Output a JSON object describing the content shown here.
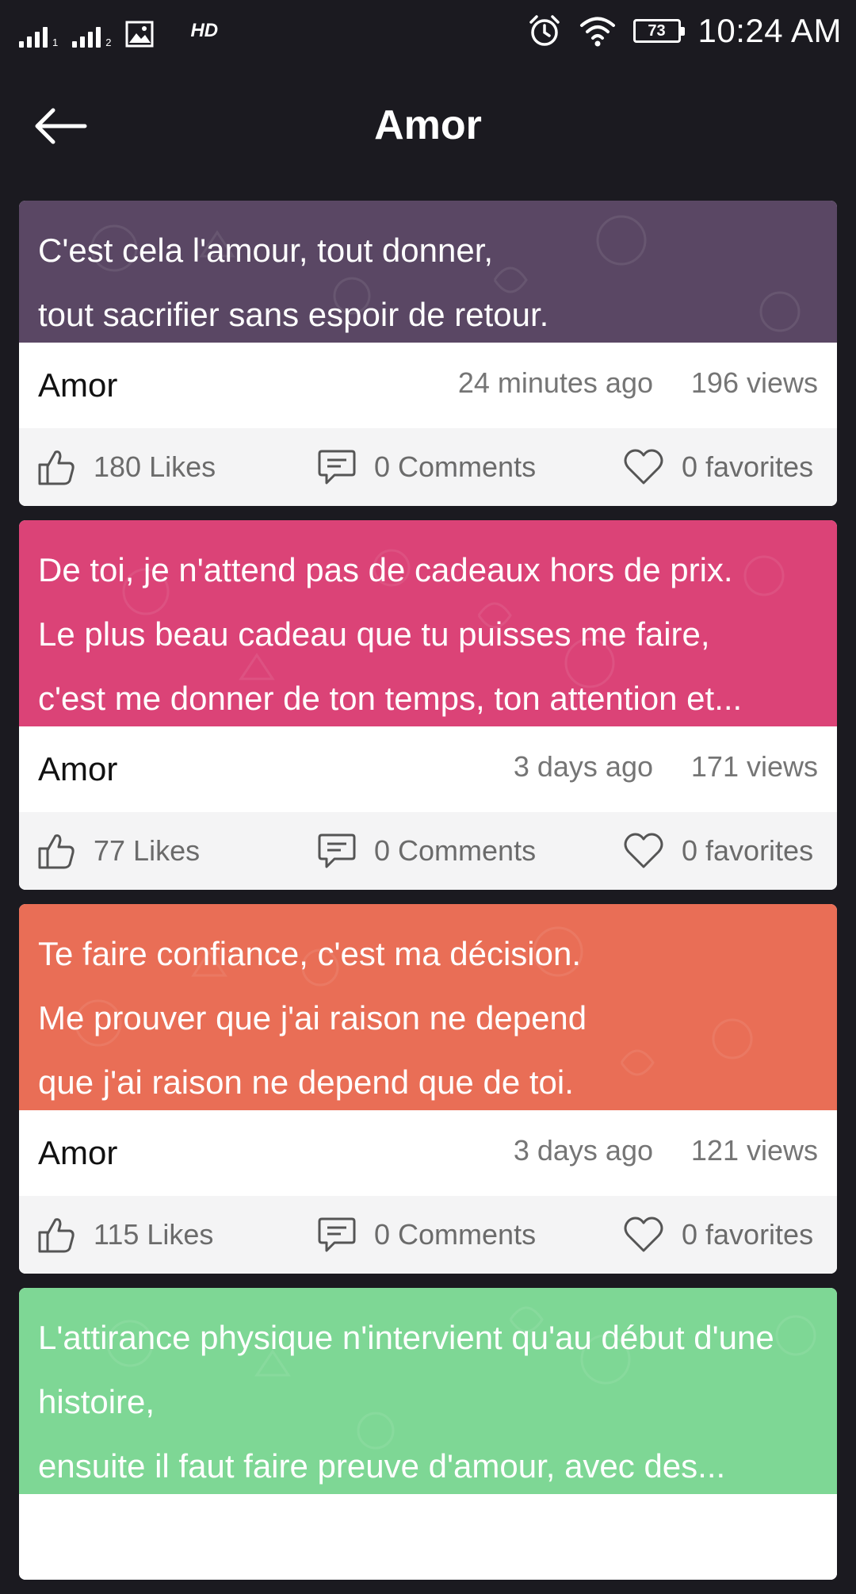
{
  "statusbar": {
    "hd": "HD",
    "battery": "73",
    "time": "10:24 AM"
  },
  "appbar": {
    "title": "Amor"
  },
  "colors": {
    "background": "#1b1a20",
    "card_purple": "#5a4764",
    "card_pink": "#db4377",
    "card_orange": "#e96e56",
    "card_green": "#7ed795"
  },
  "cards": [
    {
      "lines": [
        "C'est cela l'amour, tout donner,",
        "tout sacrifier sans espoir de retour."
      ],
      "author": "Amor",
      "time": "24 minutes ago",
      "views": "196 views",
      "likes": "180 Likes",
      "comments": "0 Comments",
      "favorites": "0 favorites"
    },
    {
      "lines": [
        "De toi, je n'attend pas de cadeaux hors de prix.",
        "Le plus beau cadeau que tu puisses me faire,",
        "c'est me donner de ton temps, ton attention et..."
      ],
      "author": "Amor",
      "time": "3 days ago",
      "views": "171 views",
      "likes": "77 Likes",
      "comments": "0 Comments",
      "favorites": "0 favorites"
    },
    {
      "lines": [
        "Te faire confiance, c'est ma décision.",
        "Me prouver que j'ai raison ne depend",
        "que j'ai raison ne depend que de toi."
      ],
      "author": "Amor",
      "time": "3 days ago",
      "views": "121 views",
      "likes": "115 Likes",
      "comments": "0 Comments",
      "favorites": "0 favorites"
    },
    {
      "lines": [
        "L'attirance physique n'intervient qu'au début d'une",
        "histoire,",
        "ensuite il faut faire preuve d'amour, avec des..."
      ]
    }
  ]
}
